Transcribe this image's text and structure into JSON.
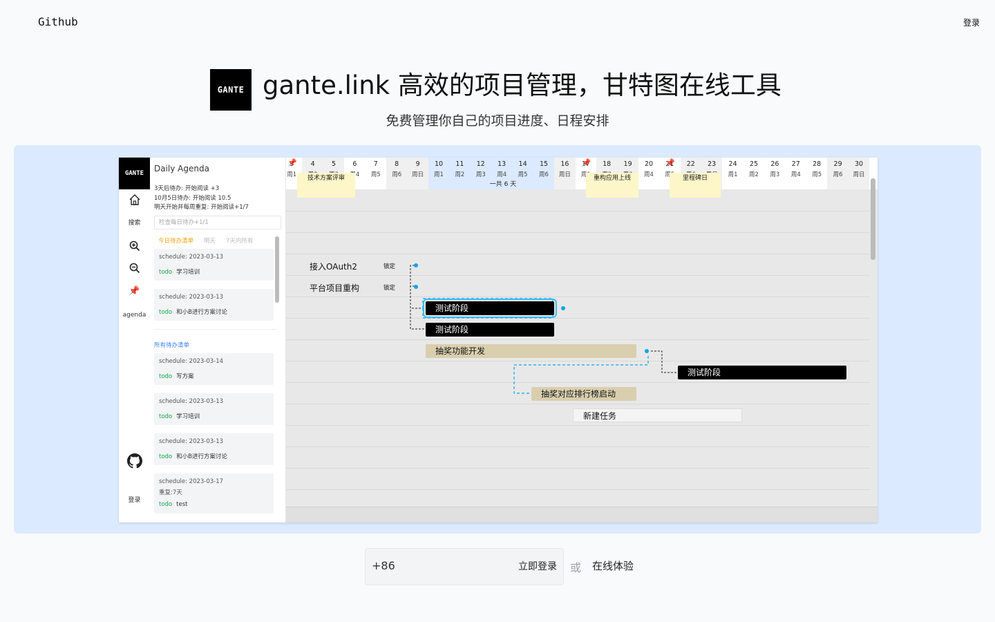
{
  "topbar": {
    "github_label": "Github",
    "login_label": "登录"
  },
  "hero": {
    "logo_text": "GANTE",
    "title": "gante.link 高效的项目管理，甘特图在线工具",
    "subtitle": "免费管理你自己的项目进度、日程安排"
  },
  "app": {
    "nav": {
      "logo_text": "GANTE",
      "search_label": "搜索",
      "agenda_label": "agenda",
      "login_label": "登录",
      "icons": [
        "home-icon",
        "zoom-in-icon",
        "zoom-out-icon",
        "pin-icon",
        "github-icon"
      ]
    },
    "agenda": {
      "title": "Daily Agenda",
      "notes": [
        "3天后待办: 开始阅读 +3",
        "10月5日待办: 开始阅读 10.5",
        "明天开始并每周重复: 开始阅读+1/7"
      ],
      "input_placeholder": "检查每日待办+1/1",
      "tabs": [
        "今日待办清单",
        "明天",
        "7天内所有"
      ],
      "today_cards": [
        {
          "schedule": "schedule:  2023-03-13",
          "todo_tag": "todo",
          "todo_text": "学习培训"
        },
        {
          "schedule": "schedule:  2023-03-13",
          "todo_tag": "todo",
          "todo_text": "和小B进行方案讨论"
        }
      ],
      "all_label": "所有待办清单",
      "all_cards": [
        {
          "schedule": "schedule:  2023-03-14",
          "todo_tag": "todo",
          "todo_text": "写方案"
        },
        {
          "schedule": "schedule:  2023-03-13",
          "todo_tag": "todo",
          "todo_text": "学习培训"
        },
        {
          "schedule": "schedule:  2023-03-13",
          "todo_tag": "todo",
          "todo_text": "和小B进行方案讨论"
        },
        {
          "schedule": "schedule:  2023-03-17",
          "extra": "重复:7天",
          "todo_tag": "todo",
          "todo_text": "test"
        }
      ]
    },
    "gantt": {
      "days": [
        {
          "n": "3",
          "w": "周1",
          "shade": ""
        },
        {
          "n": "4",
          "w": "周2",
          "shade": "grey"
        },
        {
          "n": "5",
          "w": "周3",
          "shade": "grey"
        },
        {
          "n": "6",
          "w": "周4",
          "shade": ""
        },
        {
          "n": "7",
          "w": "周5",
          "shade": ""
        },
        {
          "n": "8",
          "w": "周6",
          "shade": "grey"
        },
        {
          "n": "9",
          "w": "周日",
          "shade": "grey"
        },
        {
          "n": "10",
          "w": "周1",
          "shade": "blue"
        },
        {
          "n": "11",
          "w": "周2",
          "shade": "blue"
        },
        {
          "n": "12",
          "w": "周3",
          "shade": "blue"
        },
        {
          "n": "13",
          "w": "周4",
          "shade": "blue"
        },
        {
          "n": "14",
          "w": "周5",
          "shade": "blue"
        },
        {
          "n": "15",
          "w": "周6",
          "shade": "blue"
        },
        {
          "n": "16",
          "w": "周日",
          "shade": "grey"
        },
        {
          "n": "17",
          "w": "周1",
          "shade": ""
        },
        {
          "n": "18",
          "w": "周2",
          "shade": "grey"
        },
        {
          "n": "19",
          "w": "周3",
          "shade": "grey"
        },
        {
          "n": "20",
          "w": "周4",
          "shade": ""
        },
        {
          "n": "21",
          "w": "周5",
          "shade": ""
        },
        {
          "n": "22",
          "w": "周6",
          "shade": "grey"
        },
        {
          "n": "23",
          "w": "周日",
          "shade": "grey"
        },
        {
          "n": "24",
          "w": "周1",
          "shade": ""
        },
        {
          "n": "25",
          "w": "周2",
          "shade": ""
        },
        {
          "n": "26",
          "w": "周3",
          "shade": ""
        },
        {
          "n": "27",
          "w": "周4",
          "shade": ""
        },
        {
          "n": "28",
          "w": "周5",
          "shade": ""
        },
        {
          "n": "29",
          "w": "周6",
          "shade": "grey"
        },
        {
          "n": "30",
          "w": "周日",
          "shade": "grey"
        }
      ],
      "milestones": [
        "技术方案评审",
        "重构应用上线",
        "里程碑日"
      ],
      "range_label": "一共 6 天",
      "rows": [
        {
          "label": "接入OAuth2",
          "lock": "锁定"
        },
        {
          "label": "平台项目重构",
          "lock": "锁定"
        }
      ],
      "bars": [
        "测试阶段",
        "测试阶段",
        "抽奖功能开发",
        "测试阶段",
        "抽奖对应排行榜启动",
        "新建任务"
      ]
    }
  },
  "cta": {
    "prefix": "+86",
    "login_label": "立即登录",
    "or_label": "或",
    "demo_label": "在线体验"
  }
}
